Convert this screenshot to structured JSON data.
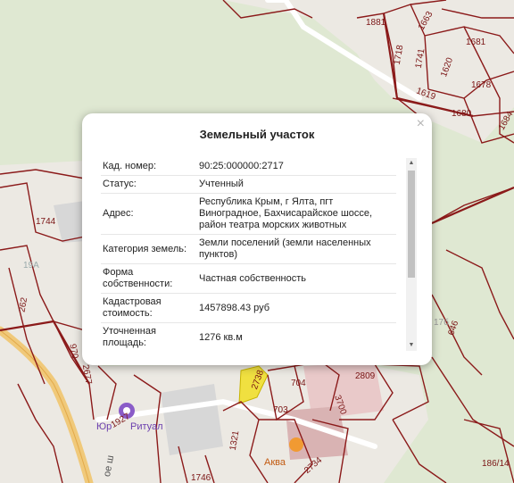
{
  "map": {
    "parcels": [
      "1881",
      "1663",
      "1681",
      "1718",
      "1741",
      "1620",
      "1678",
      "1619",
      "1680",
      "1684",
      "1744",
      "19A",
      "262",
      "970",
      "2677",
      "2738",
      "704",
      "2809",
      "703",
      "3700",
      "1321",
      "2734",
      "1746",
      "186/14",
      "17б",
      "646"
    ],
    "poi": {
      "ritual": "Ритуал",
      "ritual_prefix": "Юр",
      "ritual_number": "1927",
      "aqua": "Аква",
      "road_fragment": "ое ш"
    }
  },
  "popup": {
    "title": "Земельный участок",
    "close_icon": "close-icon",
    "rows": [
      {
        "key": "Кад. номер:",
        "value": "90:25:000000:2717"
      },
      {
        "key": "Статус:",
        "value": "Учтенный"
      },
      {
        "key": "Адрес:",
        "value": "Республика Крым, г Ялта, пгт Виноградное, Бахчисарайское шоссе, район театра морских животных"
      },
      {
        "key": "Категория земель:",
        "value": "Земли поселений (земли населенных пунктов)"
      },
      {
        "key": "Форма собственности:",
        "value": "Частная собственность"
      },
      {
        "key": "Кадастровая стоимость:",
        "value": "1457898.43 руб"
      },
      {
        "key": "Уточненная площадь:",
        "value": "1276 кв.м"
      }
    ]
  },
  "colors": {
    "parcel_border": "#8b1a1a",
    "green_area": "#dfe8d2",
    "road": "#f0c97a",
    "highlight": "#f0e040"
  }
}
